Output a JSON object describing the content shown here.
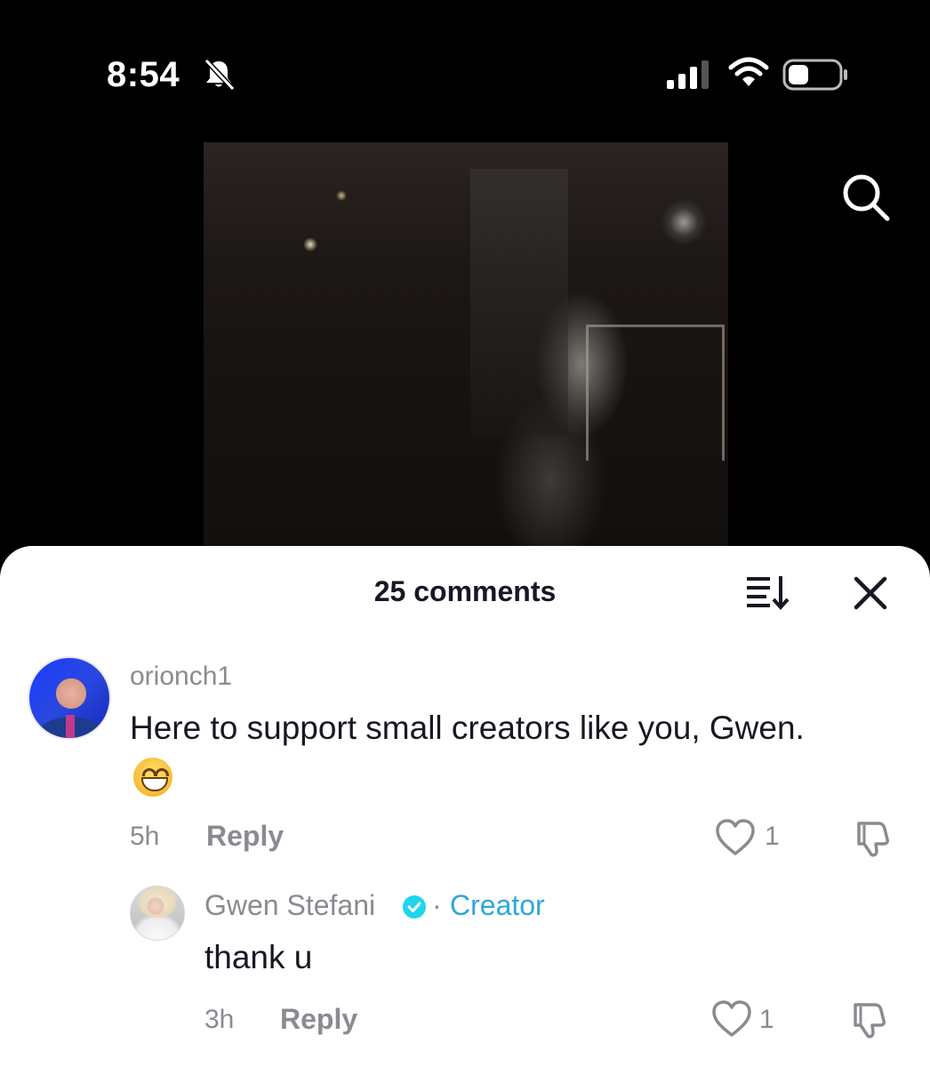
{
  "status_bar": {
    "time": "8:54",
    "icons": [
      "bell-slash-icon",
      "signal-icon",
      "wifi-icon",
      "battery-icon"
    ]
  },
  "video": {
    "search_icon": "search-icon"
  },
  "comments_sheet": {
    "title": "25 comments",
    "sort_icon": "sort-icon",
    "close_icon": "close-icon",
    "comments": [
      {
        "username": "orionch1",
        "text": "Here to support small creators like you, Gwen.",
        "emoji": "grinning-face-emoji",
        "time": "5h",
        "reply_label": "Reply",
        "likes": "1"
      }
    ],
    "replies": [
      {
        "username": "Gwen Stefani",
        "verified": true,
        "separator": "·",
        "badge": "Creator",
        "text": "thank u",
        "time": "3h",
        "reply_label": "Reply",
        "likes": "1"
      }
    ]
  },
  "colors": {
    "text_primary": "#161823",
    "text_secondary": "#8a8b91",
    "creator_badge": "#2ea8d8",
    "verified_badge": "#20d5ec"
  }
}
